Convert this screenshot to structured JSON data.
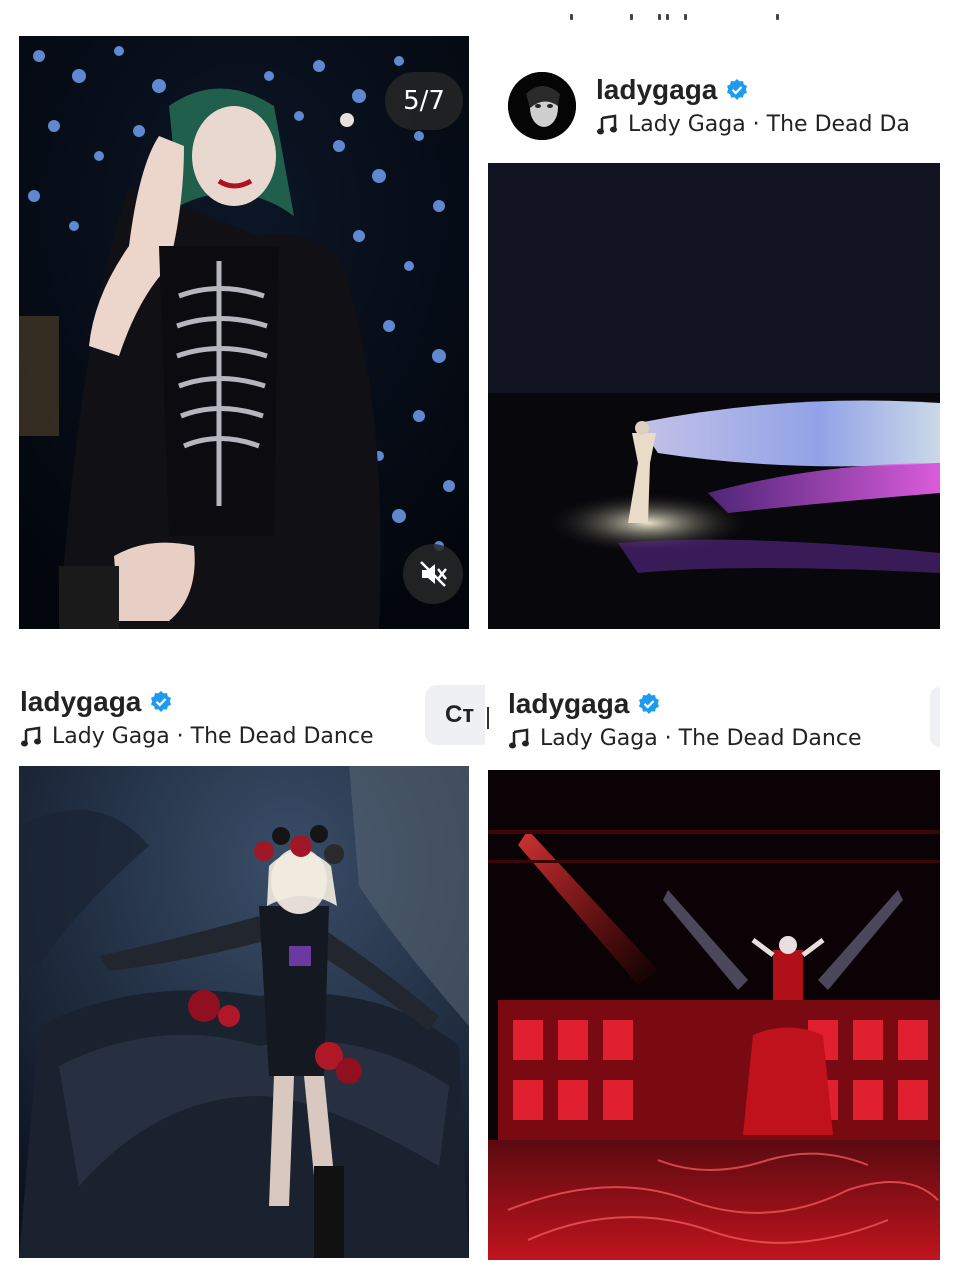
{
  "carousel": {
    "counter": "5/7"
  },
  "post2": {
    "username": "ladygaga",
    "music": "Lady Gaga · The Dead Da"
  },
  "post3": {
    "username": "ladygaga",
    "music": "Lady Gaga · The Dead Dance",
    "button_label": "Ст"
  },
  "post4": {
    "username": "ladygaga",
    "music": "Lady Gaga · The Dead Dance"
  },
  "colors": {
    "verified": "#1d9bf0",
    "text": "#222222",
    "button_bg": "#eef0f3"
  },
  "icons": [
    "verified-badge-icon",
    "music-note-icon",
    "mute-icon"
  ]
}
